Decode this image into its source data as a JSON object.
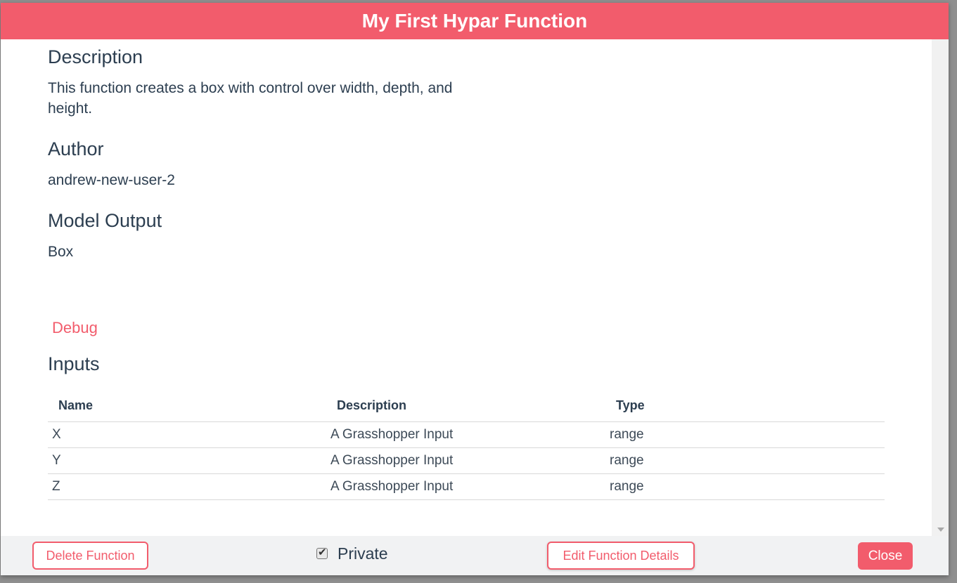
{
  "modal": {
    "title": "My First Hypar Function"
  },
  "description": {
    "heading": "Description",
    "line1": "This function creates a box with control over width, depth, and",
    "line2": "height."
  },
  "author": {
    "heading": "Author",
    "value": "andrew-new-user-2"
  },
  "model_output": {
    "heading": "Model Output",
    "value": "Box"
  },
  "debug_label": "Debug",
  "inputs": {
    "heading": "Inputs",
    "columns": [
      "Name",
      "Description",
      "Type"
    ],
    "rows": [
      {
        "name": "X",
        "description": "A Grasshopper Input",
        "type": "range"
      },
      {
        "name": "Y",
        "description": "A Grasshopper Input",
        "type": "range"
      },
      {
        "name": "Z",
        "description": "A Grasshopper Input",
        "type": "range"
      }
    ]
  },
  "footer": {
    "delete_label": "Delete Function",
    "private_label": "Private",
    "private_checked": true,
    "edit_label": "Edit Function Details",
    "close_label": "Close"
  },
  "colors": {
    "accent": "#f25c6c",
    "text": "#2c3e50",
    "footer_bg": "#f1f2f3"
  },
  "icons": {
    "checkbox": "check-icon",
    "scroll_down": "chevron-down-icon"
  }
}
